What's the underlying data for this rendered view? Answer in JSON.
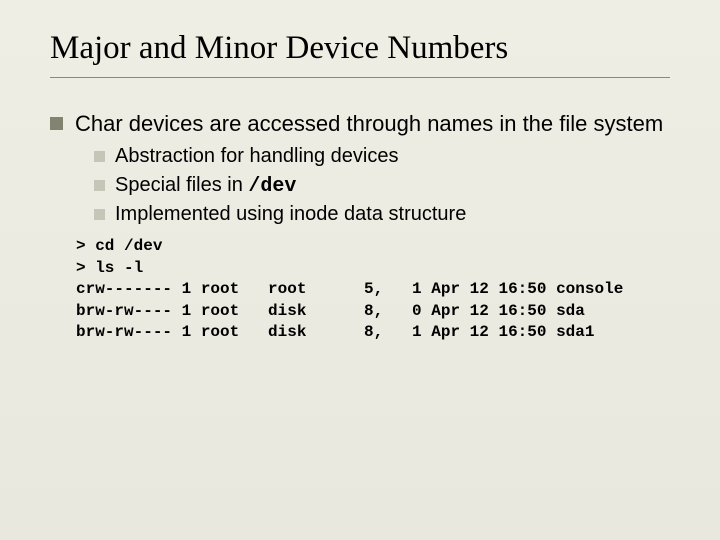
{
  "title": "Major and Minor Device Numbers",
  "main_bullet": "Char devices are accessed through names in the file system",
  "sub1": "Abstraction for handling devices",
  "sub2_pre": "Special files in ",
  "sub2_code": "/dev",
  "sub3": "Implemented using inode data structure",
  "code": "> cd /dev\n> ls -l\ncrw------- 1 root   root      5,   1 Apr 12 16:50 console\nbrw-rw---- 1 root   disk      8,   0 Apr 12 16:50 sda\nbrw-rw---- 1 root   disk      8,   1 Apr 12 16:50 sda1"
}
